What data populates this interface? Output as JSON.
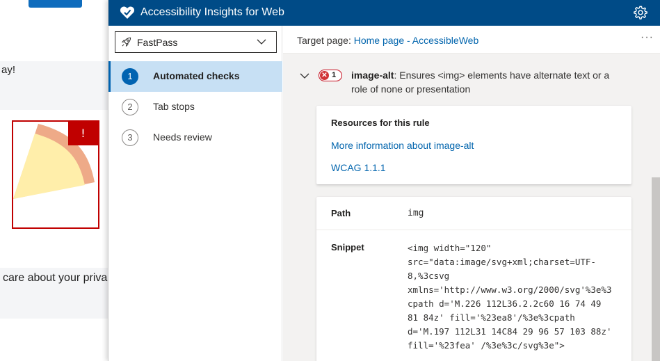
{
  "background_page": {
    "text_snippet_1": "ay!",
    "text_snippet_2": "care about your priva",
    "warning_glyph": "!"
  },
  "header": {
    "title": "Accessibility Insights for Web",
    "settings_icon": "gear-icon"
  },
  "nav": {
    "mode_dropdown": {
      "selected": "FastPass",
      "icon": "rocket-icon"
    },
    "items": [
      {
        "number": "1",
        "label": "Automated checks",
        "active": true
      },
      {
        "number": "2",
        "label": "Tab stops",
        "active": false
      },
      {
        "number": "3",
        "label": "Needs review",
        "active": false
      }
    ]
  },
  "main": {
    "target_label": "Target page:",
    "target_link": "Home page - AccessibleWeb",
    "more_menu": "···",
    "rule": {
      "failure_count": "1",
      "failure_icon": "✕",
      "name": "image-alt",
      "description": ": Ensures <img> elements have alternate text or a role of none or presentation"
    },
    "resources": {
      "title": "Resources for this rule",
      "link1": "More information about image-alt",
      "link2": "WCAG 1.1.1"
    },
    "details": {
      "path_label": "Path",
      "path_value": "img",
      "snippet_label": "Snippet",
      "snippet_value": "<img width=\"120\"\nsrc=\"data:image/svg+xml;charset=UTF-\n8,%3csvg\nxmlns='http://www.w3.org/2000/svg'%3e%3\ncpath d='M.226 112L36.2.2c60 16 74 49\n81 84z' fill='%23ea8'/%3e%3cpath\nd='M.197 112L31 14C84 29 96 57 103 88z'\nfill='%23fea' /%3e%3c/svg%3e\">"
    }
  },
  "colors": {
    "title_bar": "#004b87",
    "active_nav": "#c7e0f4",
    "link": "#0064ad",
    "error": "#c50f1f"
  }
}
